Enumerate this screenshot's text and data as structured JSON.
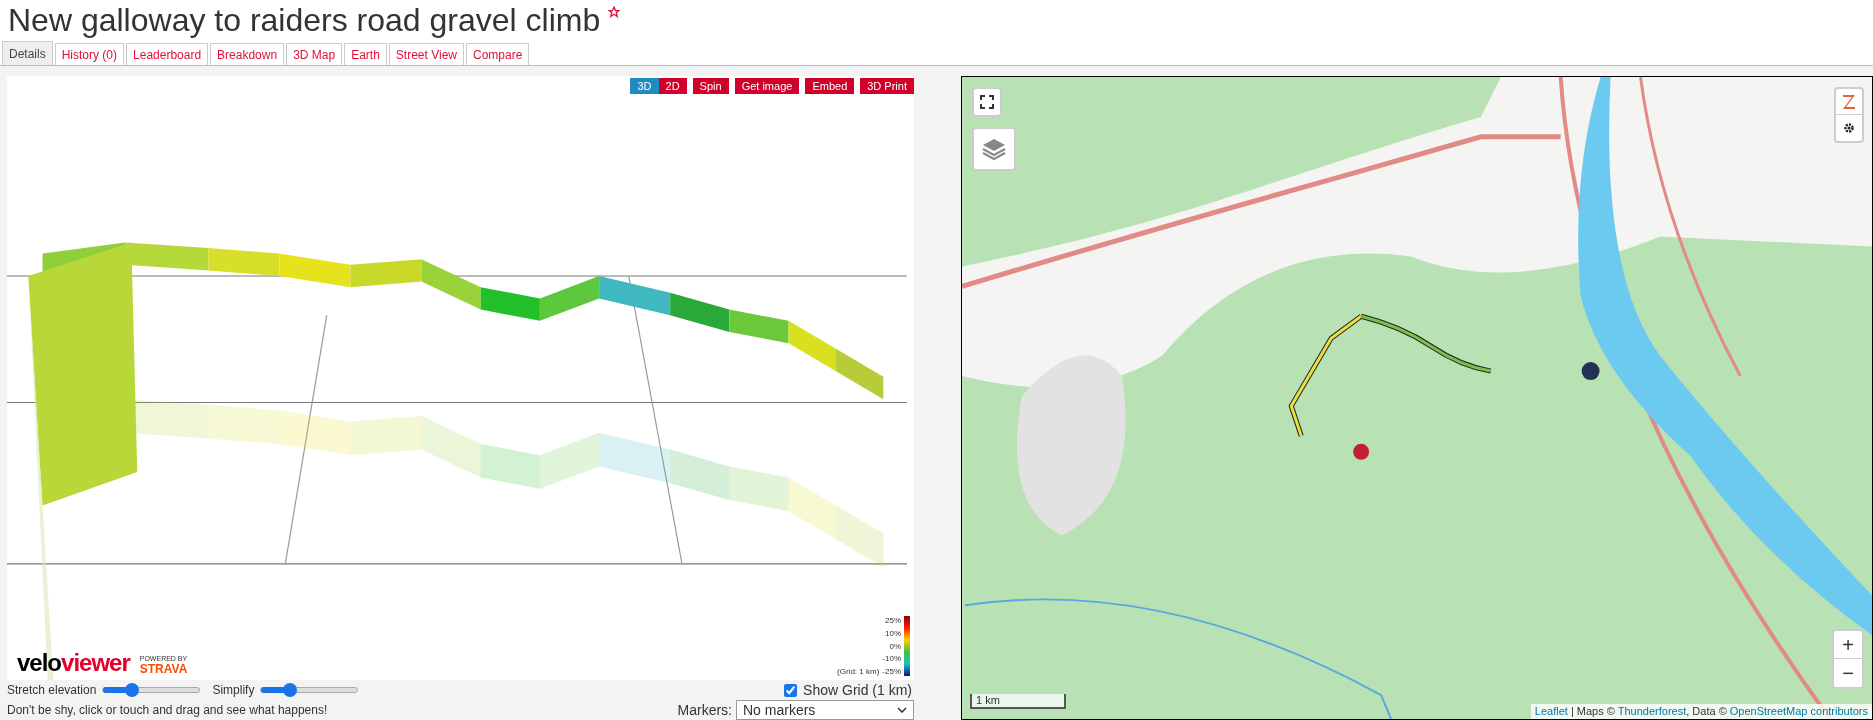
{
  "title": "New galloway to raiders road gravel climb",
  "tabs": [
    {
      "label": "Details",
      "selected": true
    },
    {
      "label": "History (0)",
      "selected": false
    },
    {
      "label": "Leaderboard",
      "selected": false
    },
    {
      "label": "Breakdown",
      "selected": false
    },
    {
      "label": "3D Map",
      "selected": false
    },
    {
      "label": "Earth",
      "selected": false
    },
    {
      "label": "Street View",
      "selected": false
    },
    {
      "label": "Compare",
      "selected": false
    }
  ],
  "view_modes": [
    {
      "label": "3D",
      "selected": true
    },
    {
      "label": "2D",
      "selected": false
    }
  ],
  "actions": [
    "Spin",
    "Get image",
    "Embed",
    "3D Print"
  ],
  "legend": {
    "labels": [
      "25%",
      "10%",
      "0%",
      "-10%",
      "-25%"
    ],
    "note": "(Grid: 1 km)"
  },
  "logo": {
    "part_1": "velo",
    "part_2": "viewer",
    "caption": "POWERED BY",
    "brand": "STRAVA"
  },
  "sliders": [
    {
      "label": "Stretch elevation",
      "level": 0.3
    },
    {
      "label": "Simplify",
      "level": 0.3
    }
  ],
  "show_grid": {
    "label": "Show Grid (1 km)",
    "checked": true
  },
  "hint": "Don't be shy, click or touch and drag and see what happens!",
  "markers": {
    "label": "Markers:",
    "value": "No markers"
  },
  "map": {
    "zoom_in": "+",
    "zoom_out": "−",
    "scale": "1 km",
    "attribution": [
      {
        "text": "Leaflet",
        "link": true
      },
      {
        "text": " | Maps © ",
        "link": false
      },
      {
        "text": "Thunderforest",
        "link": true
      },
      {
        "text": ", Data © ",
        "link": false
      },
      {
        "text": "OpenStreetMap contributors",
        "link": true
      }
    ]
  }
}
